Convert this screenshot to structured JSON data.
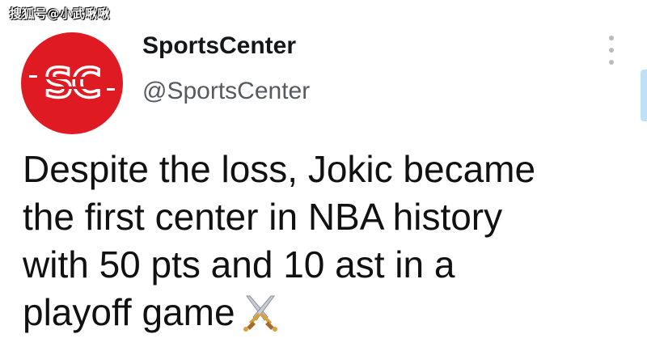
{
  "watermark": "搜狐号@小武啾啾",
  "account": {
    "display_name": "SportsCenter",
    "handle": "@SportsCenter",
    "avatar_text": "SC",
    "avatar_color": "#e01a22"
  },
  "menu": {
    "icon": "more-vertical-icon"
  },
  "tweet": {
    "lines": [
      "Despite the loss, Jokic became",
      "the first center in NBA history",
      "with 50 pts and 10 ast in a",
      "playoff game"
    ],
    "emoji_icon": "crossed-swords-icon"
  }
}
